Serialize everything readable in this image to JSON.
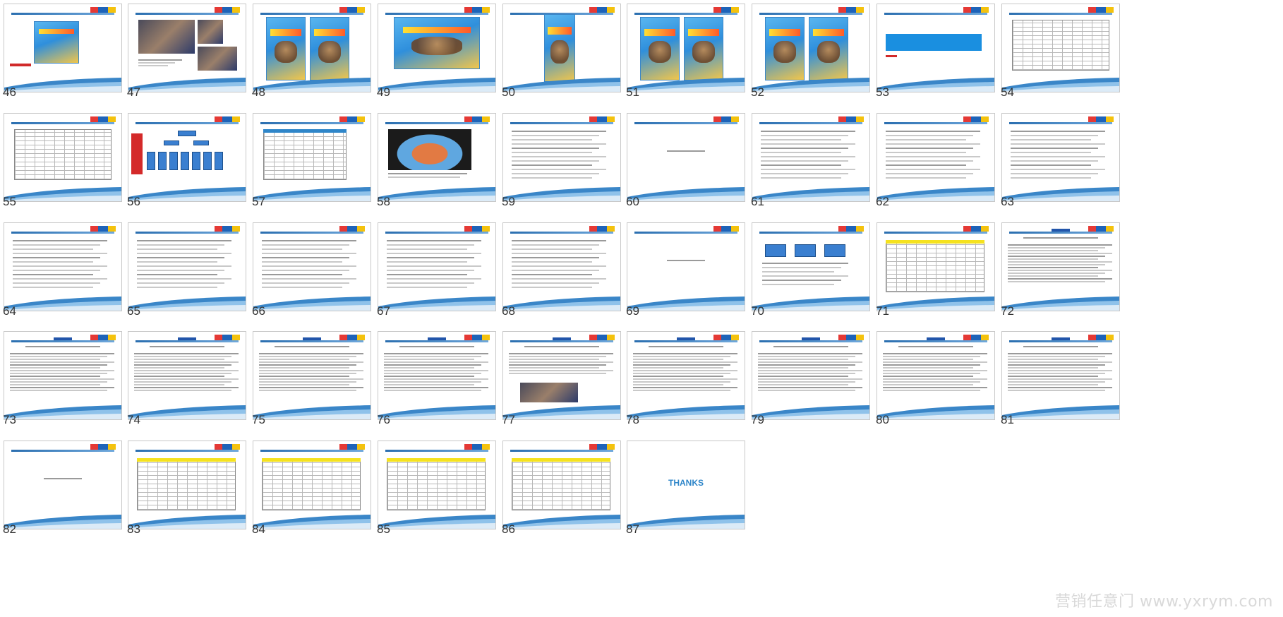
{
  "slides": [
    {
      "number": "46",
      "kind": "poster-small"
    },
    {
      "number": "47",
      "kind": "photos"
    },
    {
      "number": "48",
      "kind": "posters-two"
    },
    {
      "number": "49",
      "kind": "poster-wide"
    },
    {
      "number": "50",
      "kind": "poster-tall"
    },
    {
      "number": "51",
      "kind": "posters-two"
    },
    {
      "number": "52",
      "kind": "posters-two"
    },
    {
      "number": "53",
      "kind": "blue-banner"
    },
    {
      "number": "54",
      "kind": "table"
    },
    {
      "number": "55",
      "kind": "table"
    },
    {
      "number": "56",
      "kind": "org-chart"
    },
    {
      "number": "57",
      "kind": "table-blue"
    },
    {
      "number": "58",
      "kind": "court"
    },
    {
      "number": "59",
      "kind": "text"
    },
    {
      "number": "60",
      "kind": "section"
    },
    {
      "number": "61",
      "kind": "text"
    },
    {
      "number": "62",
      "kind": "text"
    },
    {
      "number": "63",
      "kind": "text"
    },
    {
      "number": "64",
      "kind": "text"
    },
    {
      "number": "65",
      "kind": "text"
    },
    {
      "number": "66",
      "kind": "text"
    },
    {
      "number": "67",
      "kind": "text"
    },
    {
      "number": "68",
      "kind": "text"
    },
    {
      "number": "69",
      "kind": "section"
    },
    {
      "number": "70",
      "kind": "flow"
    },
    {
      "number": "71",
      "kind": "table-yellow"
    },
    {
      "number": "72",
      "kind": "article"
    },
    {
      "number": "73",
      "kind": "article"
    },
    {
      "number": "74",
      "kind": "article"
    },
    {
      "number": "75",
      "kind": "article"
    },
    {
      "number": "76",
      "kind": "article"
    },
    {
      "number": "77",
      "kind": "article-photo"
    },
    {
      "number": "78",
      "kind": "article"
    },
    {
      "number": "79",
      "kind": "article"
    },
    {
      "number": "80",
      "kind": "article"
    },
    {
      "number": "81",
      "kind": "article"
    },
    {
      "number": "82",
      "kind": "section"
    },
    {
      "number": "83",
      "kind": "table-yellow"
    },
    {
      "number": "84",
      "kind": "table-yellow"
    },
    {
      "number": "85",
      "kind": "table-yellow"
    },
    {
      "number": "86",
      "kind": "table-yellow"
    },
    {
      "number": "87",
      "kind": "thanks",
      "title": "THANKS"
    }
  ],
  "watermark": "营销任意门 www.yxrym.com",
  "colors": {
    "accent_blue": "#2f86c9",
    "header_yellow": "#f5e21f",
    "border_gray": "#c8c8c8"
  }
}
